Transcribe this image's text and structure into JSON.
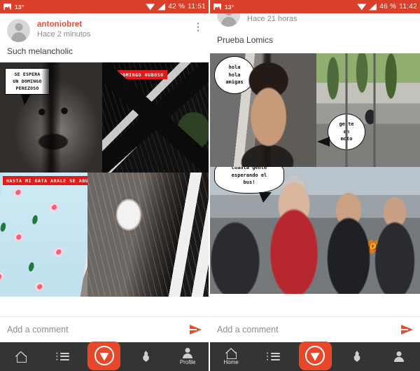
{
  "left": {
    "statusbar": {
      "photo_icon": "photo-icon",
      "temperature": "13°",
      "wifi_icon": "wifi-icon",
      "signal_icon": "signal-icon",
      "battery": "42 %",
      "time": "11:51"
    },
    "post": {
      "avatar_icon": "avatar-placeholder-icon",
      "username": "antoniobret",
      "timestamp": "Hace 2 minutos",
      "overflow_icon": "overflow-menu-icon",
      "text": "Such melancholic"
    },
    "comic": {
      "panel1": {
        "caption": "SE ESPERA\nUN DOMINGO\nPEREZOSO"
      },
      "panel2": {
        "banner": "UN DOMINGO NUBOSO"
      },
      "panel3": {
        "banner": "HASTA MI GATA ARALE SE ABURRE"
      }
    },
    "comment": {
      "placeholder": "Add a comment",
      "send_icon": "send-icon"
    },
    "nav": [
      {
        "icon": "home-icon",
        "label": ""
      },
      {
        "icon": "list-icon",
        "label": ""
      },
      {
        "icon": "lomics-logo-icon",
        "label": ""
      },
      {
        "icon": "flame-icon",
        "label": ""
      },
      {
        "icon": "person-icon",
        "label": "Profile"
      }
    ]
  },
  "right": {
    "statusbar": {
      "photo_icon": "photo-icon",
      "temperature": "13°",
      "wifi_icon": "wifi-icon",
      "signal_icon": "signal-icon",
      "battery": "46 %",
      "time": "11:42"
    },
    "post": {
      "avatar_icon": "avatar-placeholder-icon",
      "timestamp": "Hace 21 horas",
      "text": "Prueba Lomics"
    },
    "comic": {
      "panel1": {
        "bubble": "hola\nhola\namigas"
      },
      "panel2": {
        "bubble": "gente\nen\nmoto"
      },
      "panel3": {
        "bubble": "cuanta gente\nesperando el\nbus!",
        "sticker": "WOW!!"
      }
    },
    "comment": {
      "placeholder": "Add a comment",
      "send_icon": "send-icon"
    },
    "nav": [
      {
        "icon": "home-icon",
        "label": "Home"
      },
      {
        "icon": "list-icon",
        "label": ""
      },
      {
        "icon": "lomics-logo-icon",
        "label": ""
      },
      {
        "icon": "flame-icon",
        "label": ""
      },
      {
        "icon": "person-icon",
        "label": ""
      }
    ]
  },
  "colors": {
    "statusbar": "#d93f2b",
    "accent": "#e2543a",
    "navbar": "#343434",
    "logo": "#e8472a",
    "banner_red": "#e01b1b"
  }
}
